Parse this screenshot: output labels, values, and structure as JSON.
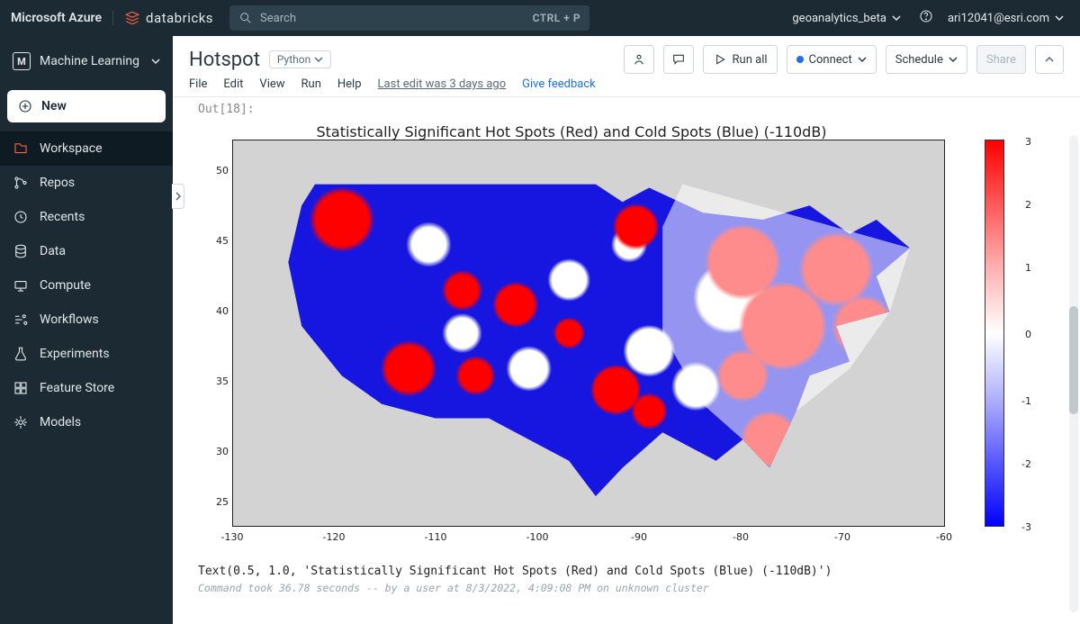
{
  "topbar": {
    "brand_ms": "Microsoft Azure",
    "brand_db": "databricks",
    "search_placeholder": "Search",
    "shortcut": "CTRL + P",
    "workspace": "geoanalytics_beta",
    "user": "ari12041@esri.com"
  },
  "sidebar": {
    "persona": "Machine Learning",
    "new_label": "New",
    "items": [
      {
        "label": "Workspace",
        "active": true
      },
      {
        "label": "Repos"
      },
      {
        "label": "Recents"
      },
      {
        "label": "Data"
      },
      {
        "label": "Compute"
      },
      {
        "label": "Workflows"
      },
      {
        "label": "Experiments"
      },
      {
        "label": "Feature Store"
      },
      {
        "label": "Models"
      }
    ]
  },
  "notebook": {
    "title": "Hotspot",
    "language": "Python",
    "menu": {
      "file": "File",
      "edit": "Edit",
      "view": "View",
      "run": "Run",
      "help": "Help"
    },
    "last_edit": "Last edit was 3 days ago",
    "feedback": "Give feedback",
    "run_all": "Run all",
    "connect": "Connect",
    "schedule": "Schedule",
    "share": "Share"
  },
  "output": {
    "label": "Out[18]:",
    "repl_text": "Text(0.5, 1.0, 'Statistically Significant Hot Spots (Red) and Cold Spots (Blue) (-110dB)')",
    "cmd_meta": "Command took 36.78 seconds -- by a user at 8/3/2022, 4:09:08 PM on unknown cluster"
  },
  "chart_data": {
    "type": "heatmap",
    "title": "Statistically Significant Hot Spots (Red) and Cold Spots (Blue) (-110dB)",
    "xlabel": "",
    "ylabel": "",
    "x_ticks": [
      -130,
      -120,
      -110,
      -100,
      -90,
      -80,
      -70,
      -60
    ],
    "y_ticks": [
      25,
      30,
      35,
      40,
      45,
      50
    ],
    "xlim": [
      -130,
      -60
    ],
    "ylim": [
      23,
      51
    ],
    "colorbar": {
      "min": -3,
      "max": 3,
      "ticks": [
        -3,
        -2,
        -1,
        0,
        1,
        2,
        3
      ]
    },
    "description": "Choropleth-style raster over contiguous United States. Western and central US dominated by cold spots (blue, negative z). Scattered circular hot spots (red, positive z) at NW coast, several interior points, and large clusters across eastern US and Florida. White indicates not significant (~0)."
  }
}
